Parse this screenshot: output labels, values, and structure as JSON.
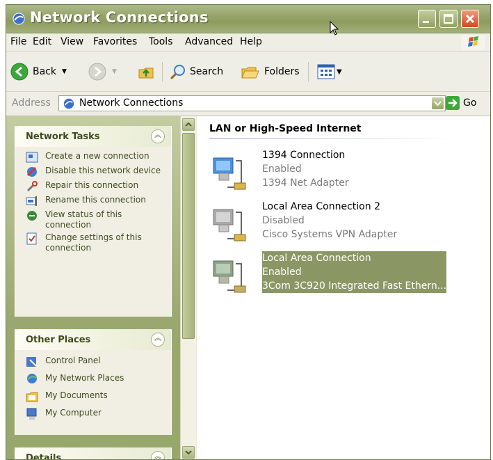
{
  "window": {
    "title": "Network Connections"
  },
  "menu": [
    "File",
    "Edit",
    "View",
    "Favorites",
    "Tools",
    "Advanced",
    "Help"
  ],
  "toolbar": {
    "back": "Back",
    "search": "Search",
    "folders": "Folders"
  },
  "address": {
    "label": "Address",
    "value": "Network Connections",
    "go": "Go"
  },
  "left_pane": {
    "network_tasks": {
      "title": "Network Tasks",
      "items": [
        "Create a new connection",
        "Disable this network device",
        "Repair this connection",
        "Rename this connection",
        "View status of this connection",
        "Change settings of this connection"
      ]
    },
    "other_places": {
      "title": "Other Places",
      "items": [
        "Control Panel",
        "My Network Places",
        "My Documents",
        "My Computer"
      ]
    },
    "details": {
      "title": "Details"
    }
  },
  "main": {
    "group_title": "LAN or High-Speed Internet",
    "connections": [
      {
        "name": "1394 Connection",
        "status": "Enabled",
        "device": "1394 Net Adapter"
      },
      {
        "name": "Local Area Connection 2",
        "status": "Disabled",
        "device": "Cisco Systems VPN Adapter"
      },
      {
        "name": "Local Area Connection",
        "status": "Enabled",
        "device": "3Com 3C920 Integrated Fast Ethern..."
      }
    ]
  },
  "colors": {
    "title_bar": "#96a46b",
    "selection": "#8a9764",
    "close_button": "#d24a23"
  }
}
